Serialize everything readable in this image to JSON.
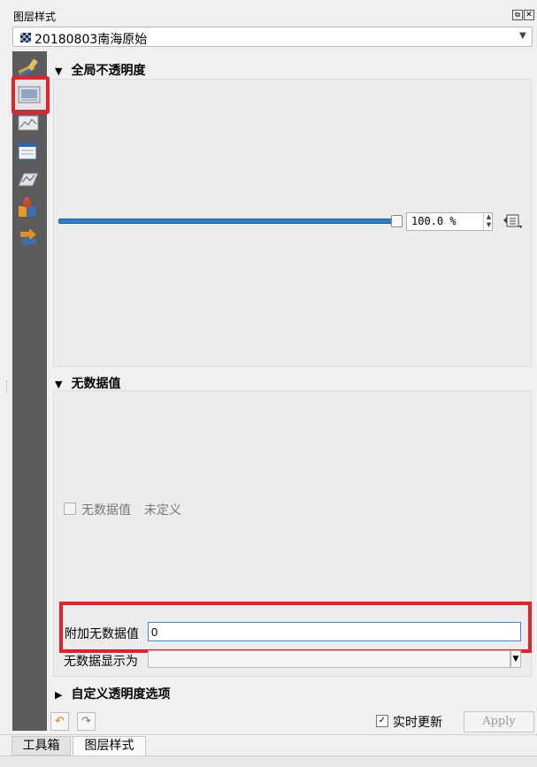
{
  "panel": {
    "title": "图层样式",
    "float_icon": "float-icon",
    "close_icon": "close-icon"
  },
  "layer_selector": {
    "value": "20180803南海原始",
    "icon": "raster-layer-icon"
  },
  "sidebar": {
    "items": [
      {
        "icon": "symbology-brush-icon"
      },
      {
        "icon": "transparency-icon",
        "selected": true
      },
      {
        "icon": "histogram-icon"
      },
      {
        "icon": "rendering-icon"
      },
      {
        "icon": "pyramids-icon"
      },
      {
        "icon": "metadata-icon"
      },
      {
        "icon": "legend-icon"
      }
    ]
  },
  "global_opacity": {
    "heading": "全局不透明度",
    "percent": 100,
    "value_text": "100.0 %"
  },
  "nodata": {
    "heading": "无数据值",
    "checkbox_label": "无数据值",
    "undefined_text": "未定义",
    "additional_label": "附加无数据值",
    "additional_value": "0",
    "display_as_label": "无数据显示为",
    "display_as_value": ""
  },
  "custom_transparency": {
    "heading": "自定义透明度选项"
  },
  "footer": {
    "live_update_label": "实时更新",
    "live_update_checked": true,
    "check_mark": "✓",
    "apply_label": "Apply"
  },
  "dock_tabs": [
    {
      "label": "工具箱"
    },
    {
      "label": "图层样式",
      "active": true
    }
  ],
  "colors": {
    "highlight_red": "#e8202a",
    "slider_blue": "#2d7fd0",
    "sidebar_bg": "#5b5b5b"
  }
}
